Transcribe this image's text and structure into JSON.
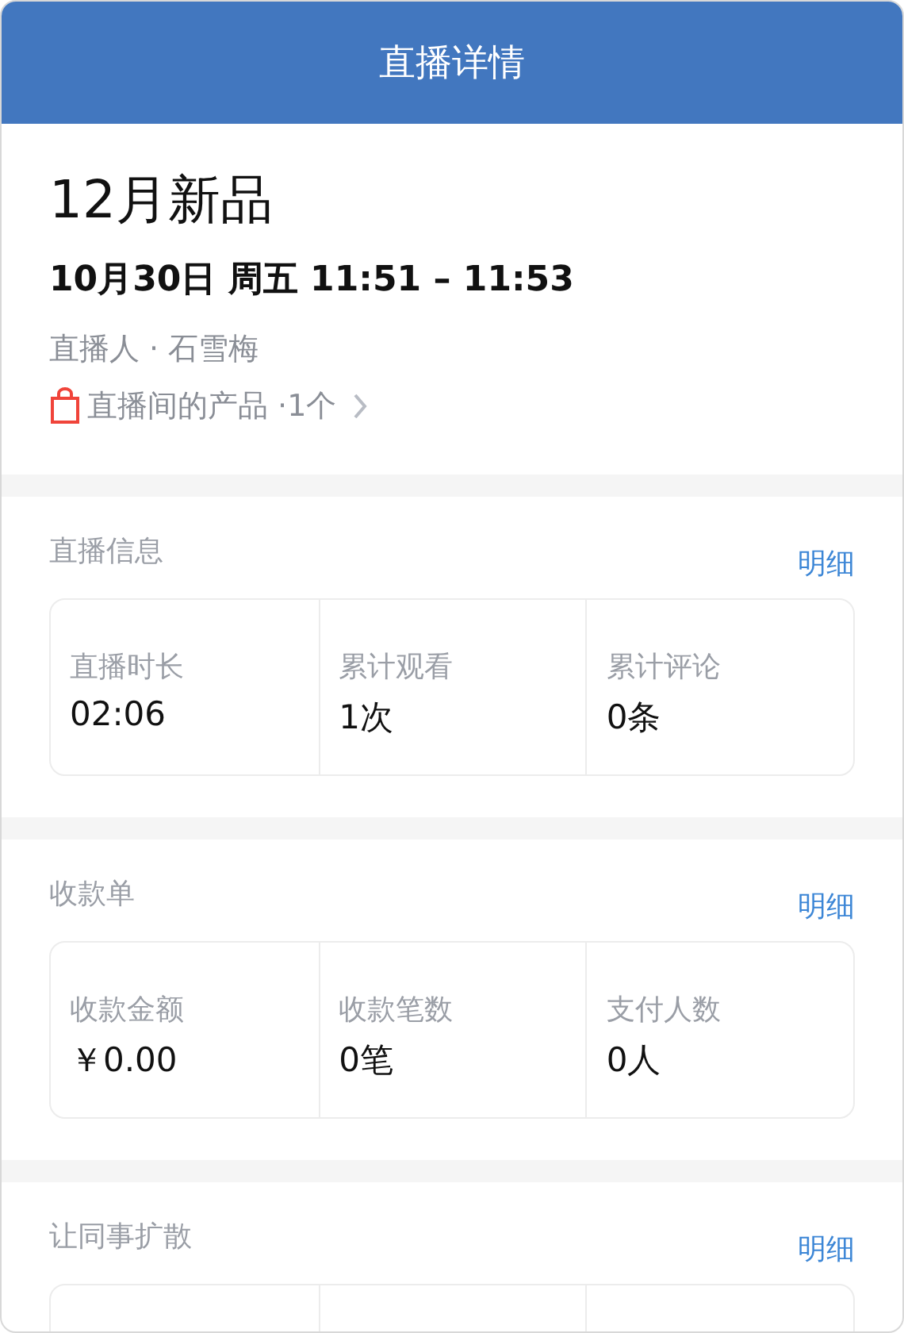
{
  "header": {
    "title": "直播详情"
  },
  "live": {
    "title": "12月新品",
    "time": "10月30日 周五 11:51 – 11:53",
    "host": "直播人 · 石雪梅",
    "products": "直播间的产品 ·1个"
  },
  "sections": [
    {
      "title": "直播信息",
      "link": "明细",
      "stats": [
        {
          "label": "直播时长",
          "value": "02:06"
        },
        {
          "label": "累计观看",
          "value": "1次"
        },
        {
          "label": "累计评论",
          "value": "0条"
        }
      ]
    },
    {
      "title": "收款单",
      "link": "明细",
      "stats": [
        {
          "label": "收款金额",
          "value": "￥0.00"
        },
        {
          "label": "收款笔数",
          "value": "0笔"
        },
        {
          "label": "支付人数",
          "value": "0人"
        }
      ]
    },
    {
      "title": "让同事扩散",
      "link": "明细"
    }
  ]
}
